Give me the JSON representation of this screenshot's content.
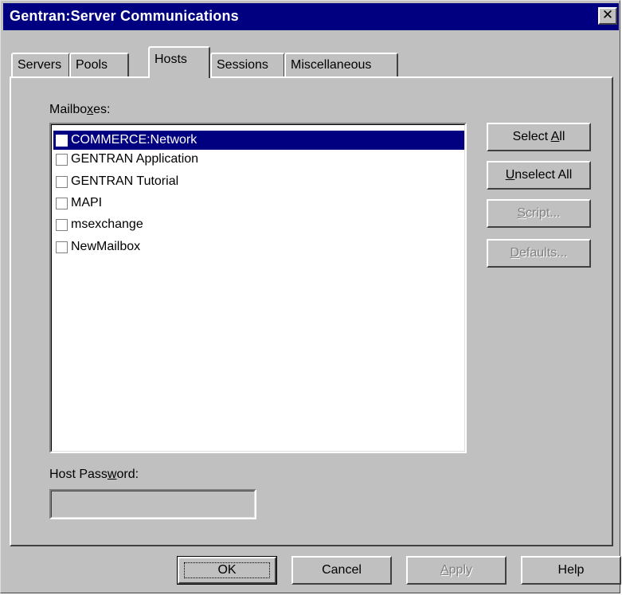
{
  "window": {
    "title": "Gentran:Server Communications",
    "close_glyph": "✕"
  },
  "tabs": [
    {
      "label": "Servers",
      "active": false
    },
    {
      "label": "Pools",
      "active": false
    },
    {
      "label": "Hosts",
      "active": true
    },
    {
      "label": "Sessions",
      "active": false
    },
    {
      "label": "Miscellaneous",
      "active": false
    }
  ],
  "mailboxes": {
    "label_pre": "Mailbo",
    "label_accel": "x",
    "label_post": "es:",
    "items": [
      {
        "label": "COMMERCE:Network",
        "checked": false,
        "selected": true
      },
      {
        "label": "GENTRAN Application",
        "checked": false,
        "selected": false
      },
      {
        "label": "GENTRAN Tutorial",
        "checked": false,
        "selected": false
      },
      {
        "label": "MAPI",
        "checked": false,
        "selected": false
      },
      {
        "label": "msexchange",
        "checked": false,
        "selected": false
      },
      {
        "label": "NewMailbox",
        "checked": false,
        "selected": false
      }
    ]
  },
  "side_buttons": {
    "select_all": {
      "pre": "Select ",
      "accel": "A",
      "post": "ll"
    },
    "unselect_all": {
      "pre": "",
      "accel": "U",
      "post": "nselect All"
    },
    "script": {
      "pre": "",
      "accel": "S",
      "post": "cript..."
    },
    "defaults": {
      "pre": "",
      "accel": "D",
      "post": "efaults..."
    }
  },
  "host_password": {
    "pre": "Host Pass",
    "accel": "w",
    "post": "ord:",
    "value": ""
  },
  "bottom_buttons": {
    "ok": "OK",
    "cancel": "Cancel",
    "apply_accel": "A",
    "apply_rest": "pply",
    "help": "Help"
  },
  "colors": {
    "titlebar": "#000080",
    "face": "#c0c0c0",
    "selection": "#000080"
  }
}
